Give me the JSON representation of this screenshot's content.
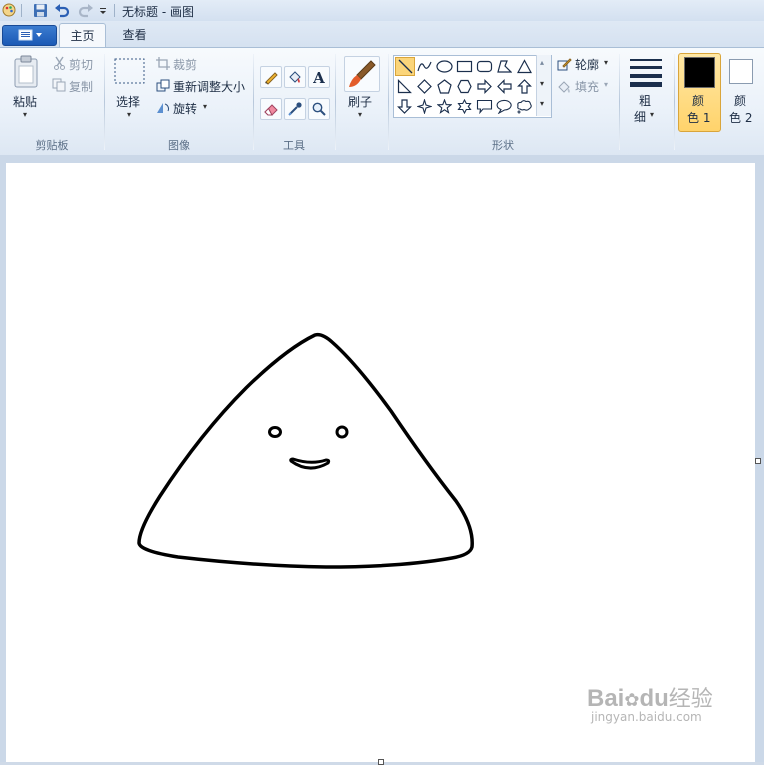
{
  "window": {
    "title": "无标题 - 画图"
  },
  "tabs": [
    {
      "label": "主页",
      "active": true
    },
    {
      "label": "查看",
      "active": false
    }
  ],
  "clipboard": {
    "paste_label": "粘贴",
    "cut_label": "剪切",
    "copy_label": "复制",
    "group_label": "剪贴板"
  },
  "image": {
    "select_label": "选择",
    "crop_label": "裁剪",
    "resize_label": "重新调整大小",
    "rotate_label": "旋转",
    "group_label": "图像"
  },
  "tools": {
    "group_label": "工具"
  },
  "brushes": {
    "label": "刷子"
  },
  "shapes": {
    "outline_label": "轮廓",
    "fill_label": "填充",
    "group_label": "形状"
  },
  "size": {
    "label_line1": "粗",
    "label_line2": "细"
  },
  "colors": {
    "color1_line1": "颜",
    "color1_line2": "色 1",
    "color2_line1": "颜",
    "color2_line2": "色 2",
    "color1": "#000000",
    "color2": "#ffffff",
    "accent": "#ffd36b"
  },
  "watermark": {
    "brand": "Bai",
    "brand_suffix": "du",
    "brand_cn": "经验",
    "url": "jingyan.baidu.com"
  }
}
